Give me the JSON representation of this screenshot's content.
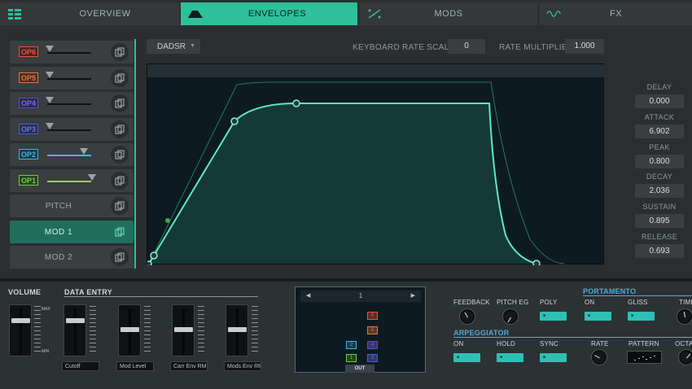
{
  "tabs": [
    {
      "id": "overview",
      "label": "OVERVIEW"
    },
    {
      "id": "envelopes",
      "label": "ENVELOPES"
    },
    {
      "id": "mods",
      "label": "MODS"
    },
    {
      "id": "fx",
      "label": "FX"
    }
  ],
  "active_tab": "envelopes",
  "colors": {
    "accent": "#2ec09a",
    "op6": "#e8523e",
    "op5": "#e0783a",
    "op4": "#5b4bc2",
    "op3": "#4e5ed0",
    "op2": "#36b8e0",
    "op1": "#6fd03c"
  },
  "operators": [
    {
      "label": "OP6",
      "level": 0.0
    },
    {
      "label": "OP5",
      "level": 0.0
    },
    {
      "label": "OP4",
      "level": 0.0
    },
    {
      "label": "OP3",
      "level": 0.0
    },
    {
      "label": "OP2",
      "level": 0.75
    },
    {
      "label": "OP1",
      "level": 0.95
    }
  ],
  "sources": [
    {
      "label": "PITCH"
    },
    {
      "label": "MOD 1",
      "selected": true
    },
    {
      "label": "MOD 2"
    }
  ],
  "envelope": {
    "type": "DADSR",
    "keyboard_rate_scaling_label": "KEYBOARD RATE SCALING",
    "keyboard_rate_scaling_value": "0",
    "rate_multiplier_label": "RATE MULTIPLIER",
    "rate_multiplier_value": "1.000",
    "params": [
      {
        "label": "DELAY",
        "value": "0.000"
      },
      {
        "label": "ATTACK",
        "value": "6.902"
      },
      {
        "label": "PEAK",
        "value": "0.800"
      },
      {
        "label": "DECAY",
        "value": "2.036"
      },
      {
        "label": "SUSTAIN",
        "value": "0.895"
      },
      {
        "label": "RELEASE",
        "value": "0.693"
      }
    ]
  },
  "volume": {
    "label": "VOLUME",
    "max_label": "MAX",
    "min_label": "MIN",
    "level": 0.75
  },
  "data_entry": {
    "label": "DATA ENTRY",
    "faders": [
      {
        "name": "Cutoff",
        "level": 0.75
      },
      {
        "name": "Mod Level",
        "level": 0.55
      },
      {
        "name": "Carr Env RM",
        "level": 0.55
      },
      {
        "name": "Mods Env RM",
        "level": 0.55
      }
    ]
  },
  "algorithm": {
    "number": "1",
    "prev_label": "◀",
    "next_label": "▶",
    "out_label": "OUT",
    "boxes": [
      {
        "label": "6",
        "color": "op6"
      },
      {
        "label": "5",
        "color": "op5"
      },
      {
        "label": "4",
        "color": "op4"
      },
      {
        "label": "3",
        "color": "op3"
      },
      {
        "label": "2",
        "color": "op2"
      },
      {
        "label": "1",
        "color": "op1"
      }
    ]
  },
  "controls": {
    "feedback": "FEEDBACK",
    "pitch_eg": "PITCH EG",
    "poly": "POLY",
    "portamento": {
      "label": "PORTAMENTO",
      "on": "ON",
      "gliss": "GLISS",
      "time": "TIME"
    },
    "arpeggiator": {
      "label": "ARPEGGIATOR",
      "on": "ON",
      "hold": "HOLD",
      "sync": "SYNC",
      "rate": "RATE",
      "pattern": "PATTERN",
      "octave": "OCTAVE"
    }
  }
}
